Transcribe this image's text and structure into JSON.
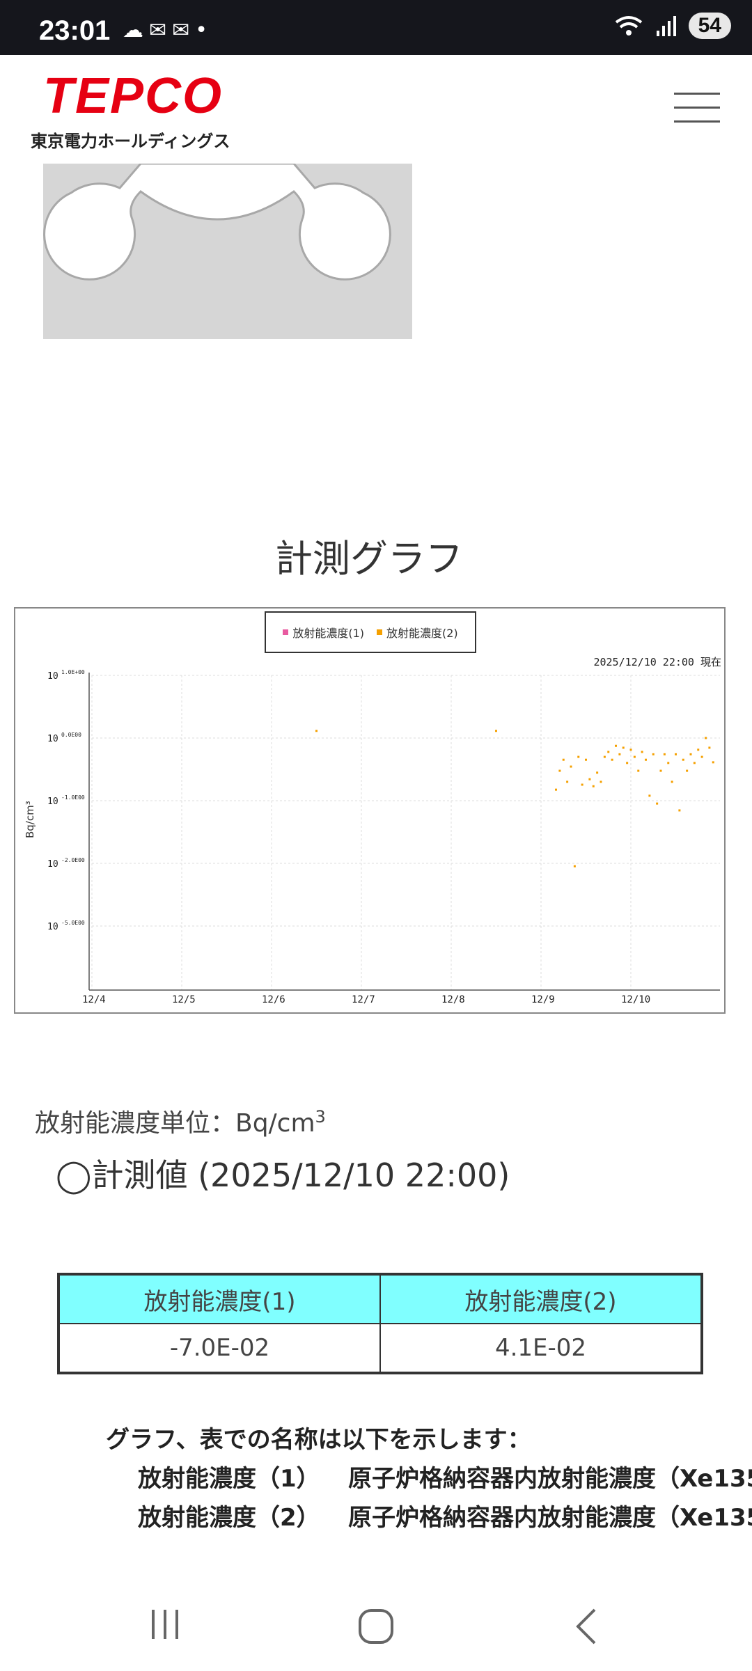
{
  "status_bar": {
    "time": "23:01",
    "left_icons": [
      "cloud-icon",
      "mail-icon",
      "mail-icon",
      "dot-icon"
    ],
    "right_icons": [
      "wifi-icon",
      "signal-icon"
    ],
    "battery": "54"
  },
  "header": {
    "logo": "TEPCO",
    "logo_sub": "東京電力ホールディングス",
    "menu_icon": "hamburger-menu-icon"
  },
  "graph_title": "計測グラフ",
  "chart_data": {
    "type": "scatter",
    "series": [
      {
        "name": "放射能濃度(1)",
        "color": "#e85aa0",
        "points": []
      },
      {
        "name": "放射能濃度(2)",
        "color": "#f5a000",
        "points": [
          [
            "12/6 12:00",
            0.13
          ],
          [
            "12/8 12:00",
            0.13
          ],
          [
            "12/9 04:00",
            0.015
          ],
          [
            "12/9 05:00",
            0.03
          ],
          [
            "12/9 06:00",
            0.045
          ],
          [
            "12/9 07:00",
            0.02
          ],
          [
            "12/9 08:00",
            0.035
          ],
          [
            "12/9 09:00",
            0.0009
          ],
          [
            "12/9 10:00",
            0.05
          ],
          [
            "12/9 11:00",
            0.018
          ],
          [
            "12/9 12:00",
            0.045
          ],
          [
            "12/9 13:00",
            0.022
          ],
          [
            "12/9 14:00",
            0.017
          ],
          [
            "12/9 15:00",
            0.028
          ],
          [
            "12/9 16:00",
            0.02
          ],
          [
            "12/9 17:00",
            0.05
          ],
          [
            "12/9 18:00",
            0.06
          ],
          [
            "12/9 19:00",
            0.045
          ],
          [
            "12/9 20:00",
            0.075
          ],
          [
            "12/9 21:00",
            0.055
          ],
          [
            "12/9 22:00",
            0.07
          ],
          [
            "12/9 23:00",
            0.04
          ],
          [
            "12/10 00:00",
            0.065
          ],
          [
            "12/10 01:00",
            0.05
          ],
          [
            "12/10 02:00",
            0.03
          ],
          [
            "12/10 03:00",
            0.06
          ],
          [
            "12/10 04:00",
            0.045
          ],
          [
            "12/10 05:00",
            0.012
          ],
          [
            "12/10 06:00",
            0.055
          ],
          [
            "12/10 07:00",
            0.009
          ],
          [
            "12/10 08:00",
            0.03
          ],
          [
            "12/10 09:00",
            0.055
          ],
          [
            "12/10 10:00",
            0.04
          ],
          [
            "12/10 11:00",
            0.02
          ],
          [
            "12/10 12:00",
            0.055
          ],
          [
            "12/10 13:00",
            0.007
          ],
          [
            "12/10 14:00",
            0.045
          ],
          [
            "12/10 15:00",
            0.03
          ],
          [
            "12/10 16:00",
            0.055
          ],
          [
            "12/10 17:00",
            0.04
          ],
          [
            "12/10 18:00",
            0.065
          ],
          [
            "12/10 19:00",
            0.05
          ],
          [
            "12/10 20:00",
            0.1
          ],
          [
            "12/10 21:00",
            0.07
          ],
          [
            "12/10 22:00",
            0.041
          ]
        ]
      }
    ],
    "x_ticks": [
      "12/4",
      "12/5",
      "12/6",
      "12/7",
      "12/8",
      "12/9",
      "12/10"
    ],
    "y_ticks": [
      {
        "value": 1,
        "label": "10",
        "exp": "1.0E+00"
      },
      {
        "value": 0.1,
        "label": "10",
        "exp": "0.0E00"
      },
      {
        "value": 0.01,
        "label": "10",
        "exp": "-1.0E00"
      },
      {
        "value": 0.001,
        "label": "10",
        "exp": "-2.0E00"
      },
      {
        "value": 0.0001,
        "label": "10",
        "exp": "-5.0E00"
      }
    ],
    "ylabel": "Bq/cm³",
    "xlabel": "",
    "y_scale": "log",
    "timestamp": "2025/12/10 22:00 現在",
    "grid": true,
    "legend_position": "top-center"
  },
  "unit_text": "放射能濃度単位：Bq/cm",
  "unit_sup": "3",
  "measure_label": "◯計測値 (2025/12/10 22:00)",
  "table": {
    "headers": [
      "放射能濃度(1)",
      "放射能濃度(2)"
    ],
    "values": [
      "-7.0E-02",
      "4.1E-02"
    ]
  },
  "notes": {
    "intro": "グラフ、表での名称は以下を示します：",
    "rows": [
      {
        "label": "放射能濃度（1）",
        "desc": "原子炉格納容器内放射能濃度（Xe135"
      },
      {
        "label": "放射能濃度（2）",
        "desc": "原子炉格納容器内放射能濃度（Xe135"
      }
    ]
  },
  "nav": [
    "recent-apps-icon",
    "home-icon",
    "back-icon"
  ]
}
